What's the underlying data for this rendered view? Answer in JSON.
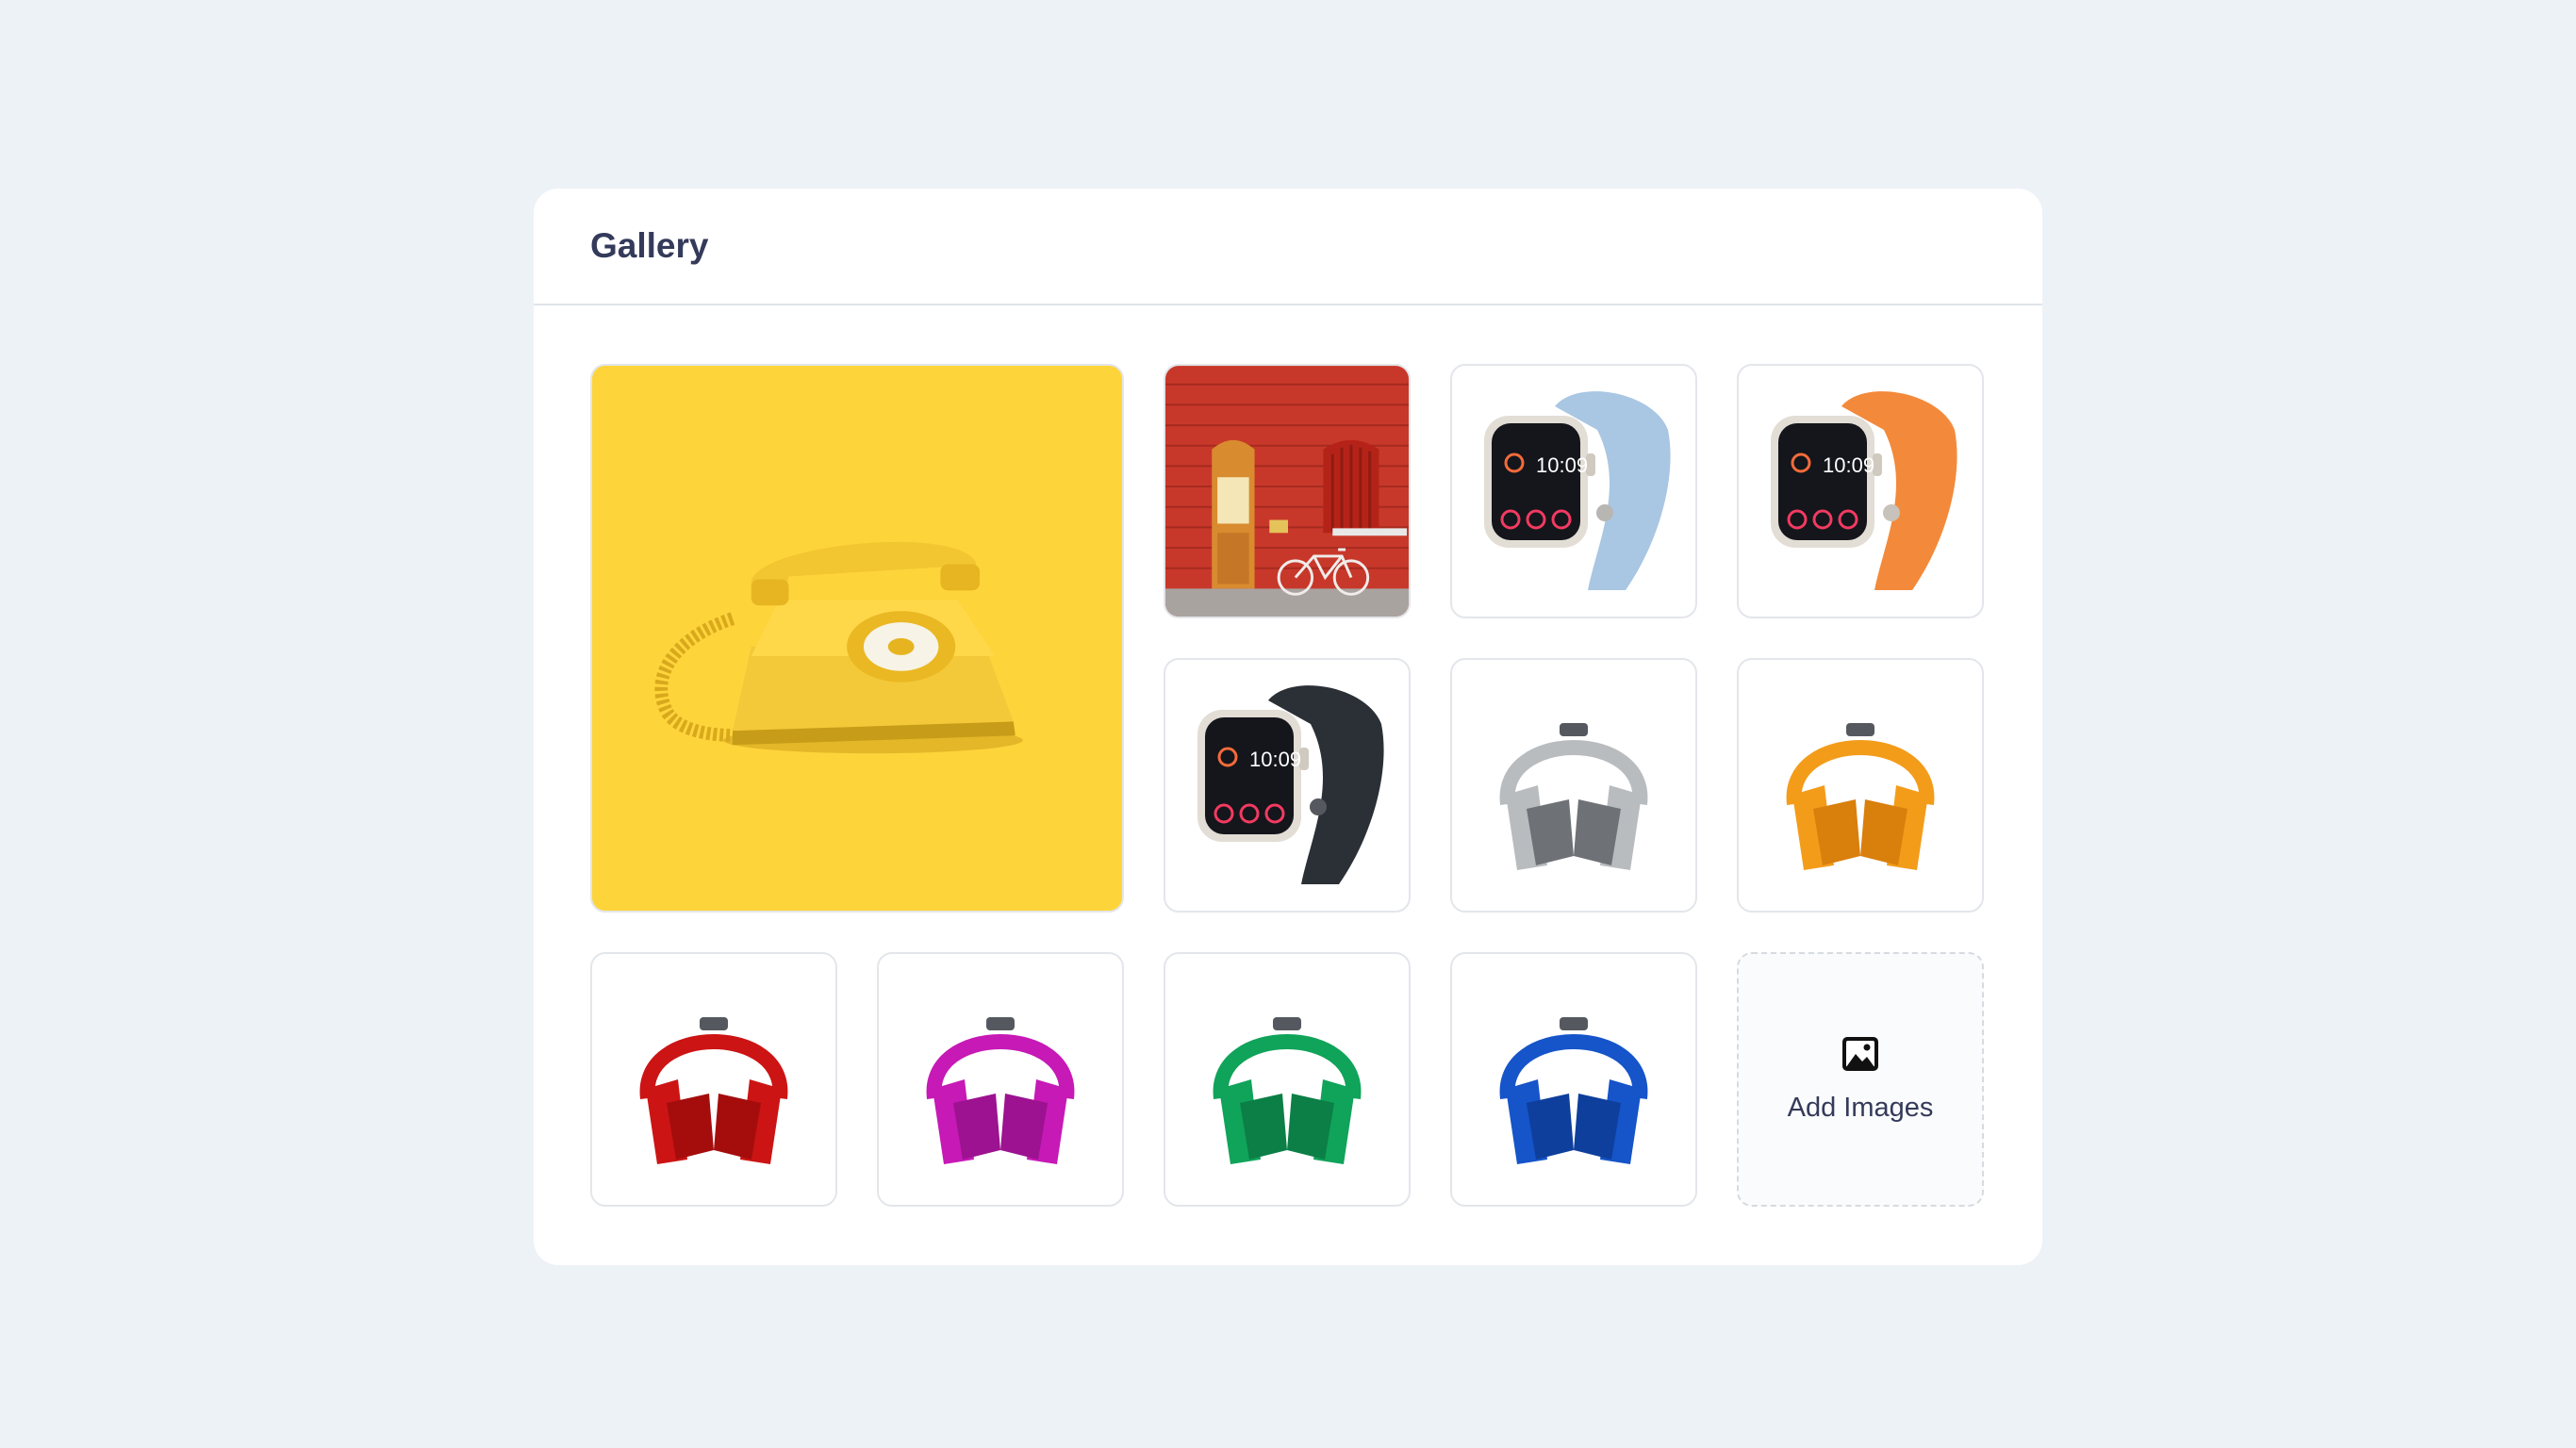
{
  "gallery": {
    "title": "Gallery",
    "images": [
      {
        "name": "yellow-rotary-telephone"
      },
      {
        "name": "red-brick-wall-bicycle"
      },
      {
        "name": "smartwatch-light-blue",
        "watch_time": "10:09",
        "band_color": "#a9c6e3"
      },
      {
        "name": "smartwatch-orange",
        "watch_time": "10:09",
        "band_color": "#f38a3b"
      },
      {
        "name": "smartwatch-black",
        "watch_time": "10:09",
        "band_color": "#2b2f36"
      },
      {
        "name": "headphones-silver",
        "color": "#b9bcbf"
      },
      {
        "name": "headphones-orange",
        "color": "#f39c1a"
      },
      {
        "name": "headphones-red",
        "color": "#cc1414"
      },
      {
        "name": "headphones-magenta",
        "color": "#c619b5"
      },
      {
        "name": "headphones-green",
        "color": "#10a35a"
      },
      {
        "name": "headphones-blue",
        "color": "#1554c9"
      }
    ],
    "add_images": {
      "label": "Add Images",
      "icon": "image-icon"
    }
  }
}
